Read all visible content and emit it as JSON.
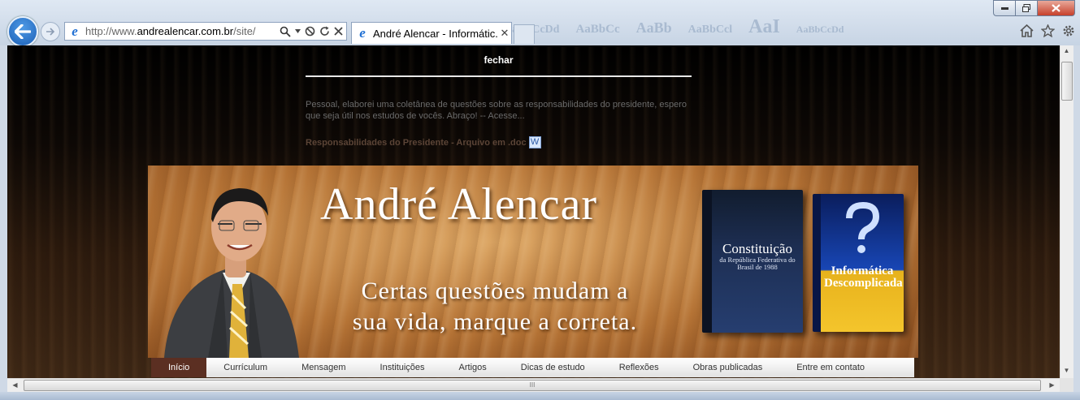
{
  "browser": {
    "url_prefix": "http://www.",
    "url_domain": "andrealencar.com.br",
    "url_path": "/site/",
    "tab_title": "André Alencar - Informátic...",
    "tab_close": "✕"
  },
  "popup": {
    "close_label": "fechar",
    "message": "Pessoal, elaborei uma coletânea de questões sobre as responsabilidades do presidente, espero que seja útil nos estudos de vocês. Abraço! -- Acesse...",
    "link_label": "Responsabilidades do Presidente - Arquivo em .doc"
  },
  "banner": {
    "title": "André Alencar",
    "slogan_line1": "Certas questões mudam a",
    "slogan_line2": "sua vida, marque a correta.",
    "book1_title": "Constituição",
    "book1_subtitle": "da República Federativa do Brasil de 1988",
    "book2_title": "Informática Descomplicada"
  },
  "nav": {
    "items": [
      {
        "label": "Início",
        "active": true
      },
      {
        "label": "Currículum"
      },
      {
        "label": "Mensagem"
      },
      {
        "label": "Instituições"
      },
      {
        "label": "Artigos"
      },
      {
        "label": "Dicas de estudo"
      },
      {
        "label": "Reflexões"
      },
      {
        "label": "Obras publicadas"
      },
      {
        "label": "Entre em contato"
      }
    ]
  },
  "colors": {
    "nav_active": "#5b2f22",
    "popup_link": "#5b4436",
    "page_bg_top": "#000000",
    "page_bg_bottom": "#3d2715"
  },
  "icons": [
    "back-arrow-icon",
    "forward-arrow-icon",
    "ie-logo-icon",
    "search-icon",
    "stop-icon",
    "refresh-icon",
    "close-icon",
    "home-icon",
    "favorites-star-icon",
    "settings-gear-icon",
    "doc-file-icon"
  ]
}
